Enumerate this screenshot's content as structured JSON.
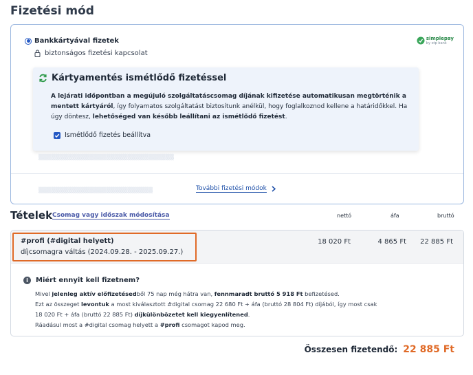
{
  "header": {
    "title": "Fizetési mód"
  },
  "payment": {
    "method_label": "Bankkártyával fizetek",
    "secure_label": "biztonságos fizetési kapcsolat",
    "brand": {
      "name": "simplepay",
      "sub": "by otp bank"
    },
    "recurring": {
      "title": "Kártyamentés ismétlődő fizetéssel",
      "text_parts": [
        "A lejárati időpontban a megújuló szolgáltatáscsomag díjának kifizetése automatikusan megtörténik a mentett kártyáról",
        ", így folyamatos szolgáltatást biztosítunk anélkül, hogy foglalkoznod kellene a határidőkkel. Ha úgy döntesz, ",
        "lehetőséged van később leállítani az ismétlődő fizetést",
        "."
      ],
      "checkbox_label": "Ismétlődő fizetés beállítva",
      "checked": true
    },
    "more_methods": "További fizetési módok"
  },
  "items": {
    "title": "Tételek",
    "modify_link": "Csomag vagy időszak módosítása",
    "columns": {
      "net": "nettó",
      "vat": "áfa",
      "gross": "bruttó"
    },
    "rows": [
      {
        "name": "#profi (#digital helyett)",
        "description": "díjcsomagra váltás (2024.09.28. - 2025.09.27.)",
        "net": "18 020 Ft",
        "vat": "4 865 Ft",
        "gross": "22 885 Ft"
      }
    ],
    "why": {
      "title": "Miért ennyit kell fizetnem?",
      "line1_a": "Mivel ",
      "line1_b": "jelenleg aktív előfizetésed",
      "line1_c": "ből 75 nap még hátra van, ",
      "line1_d": "fennmaradt bruttó 5 918 Ft",
      "line1_e": " befizetésed.",
      "line2_a": "Ezt az összeget ",
      "line2_b": "levontuk",
      "line2_c": " a most kiválasztott #digital csomag 22 680 Ft + áfa (bruttó 28 804 Ft) díjából, így most csak",
      "line3_a": "18 020 Ft + áfa (bruttó 22 885 Ft) ",
      "line3_b": "díjkülönbözetet kell kiegyenlítened",
      "line3_c": ".",
      "line4_a": "Ráadásul most a #digital csomag helyett a ",
      "line4_b": "#profi",
      "line4_c": " csomagot kapod meg."
    }
  },
  "total": {
    "label": "Összesen fizetendő:",
    "value": "22 885 Ft"
  },
  "colors": {
    "accent": "#e06a27",
    "primary": "#2458c4",
    "link": "#1d4fa8"
  }
}
